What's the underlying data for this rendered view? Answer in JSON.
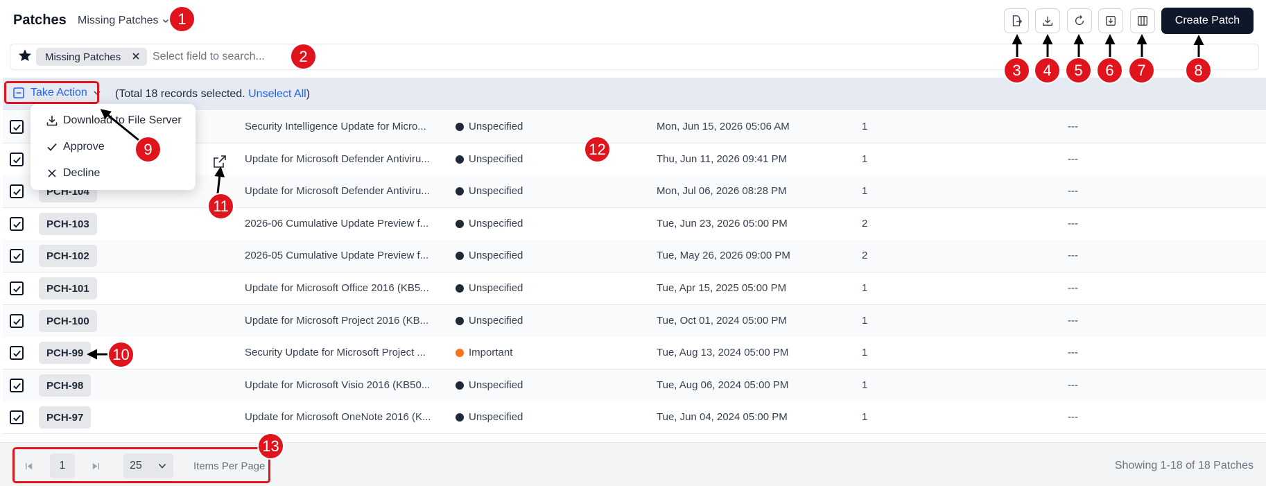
{
  "header": {
    "title": "Patches",
    "view_select": "Missing Patches",
    "create_button": "Create Patch",
    "tools": [
      {
        "name": "export-icon"
      },
      {
        "name": "download-icon"
      },
      {
        "name": "refresh-icon"
      },
      {
        "name": "import-icon"
      },
      {
        "name": "columns-icon"
      }
    ]
  },
  "search": {
    "chip": "Missing Patches",
    "placeholder": "Select field to search..."
  },
  "action_bar": {
    "take_action": "Take Action",
    "selection_text": "(Total 18 records selected.",
    "unselect_all": "Unselect All",
    "close_paren": ")"
  },
  "menu": {
    "items": [
      "Download to File Server",
      "Approve",
      "Decline"
    ]
  },
  "rows": [
    {
      "id": "",
      "name": "Security Intelligence Update for Micro...",
      "severity": "Unspecified",
      "severity_color": "#1f2937",
      "date": "Mon, Jun 15, 2026 05:06 AM",
      "count": "1",
      "extra": "---"
    },
    {
      "id": "",
      "name": "Update for Microsoft Defender Antiviru...",
      "severity": "Unspecified",
      "severity_color": "#1f2937",
      "date": "Thu, Jun 11, 2026 09:41 PM",
      "count": "1",
      "extra": "---"
    },
    {
      "id": "PCH-104",
      "name": "Update for Microsoft Defender Antiviru...",
      "severity": "Unspecified",
      "severity_color": "#1f2937",
      "date": "Mon, Jul 06, 2026 08:28 PM",
      "count": "1",
      "extra": "---"
    },
    {
      "id": "PCH-103",
      "name": "2026-06 Cumulative Update Preview f...",
      "severity": "Unspecified",
      "severity_color": "#1f2937",
      "date": "Tue, Jun 23, 2026 05:00 PM",
      "count": "2",
      "extra": "---"
    },
    {
      "id": "PCH-102",
      "name": "2026-05 Cumulative Update Preview f...",
      "severity": "Unspecified",
      "severity_color": "#1f2937",
      "date": "Tue, May 26, 2026 09:00 PM",
      "count": "2",
      "extra": "---"
    },
    {
      "id": "PCH-101",
      "name": "Update for Microsoft Office 2016 (KB5...",
      "severity": "Unspecified",
      "severity_color": "#1f2937",
      "date": "Tue, Apr 15, 2025 05:00 PM",
      "count": "1",
      "extra": "---"
    },
    {
      "id": "PCH-100",
      "name": "Update for Microsoft Project 2016 (KB...",
      "severity": "Unspecified",
      "severity_color": "#1f2937",
      "date": "Tue, Oct 01, 2024 05:00 PM",
      "count": "1",
      "extra": "---"
    },
    {
      "id": "PCH-99",
      "name": "Security Update for Microsoft Project ...",
      "severity": "Important",
      "severity_color": "#f97316",
      "date": "Tue, Aug 13, 2024 05:00 PM",
      "count": "1",
      "extra": "---"
    },
    {
      "id": "PCH-98",
      "name": "Update for Microsoft Visio 2016 (KB50...",
      "severity": "Unspecified",
      "severity_color": "#1f2937",
      "date": "Tue, Aug 06, 2024 05:00 PM",
      "count": "1",
      "extra": "---"
    },
    {
      "id": "PCH-97",
      "name": "Update for Microsoft OneNote 2016 (K...",
      "severity": "Unspecified",
      "severity_color": "#1f2937",
      "date": "Tue, Jun 04, 2024 05:00 PM",
      "count": "1",
      "extra": "---"
    }
  ],
  "footer": {
    "page": "1",
    "per_page": "25",
    "items_per_page": "Items Per Page",
    "showing": "Showing 1-18 of 18 Patches"
  },
  "annotations": [
    "1",
    "2",
    "3",
    "4",
    "5",
    "6",
    "7",
    "8",
    "9",
    "10",
    "11",
    "12",
    "13"
  ],
  "colors": {
    "annotation": "#e0141d",
    "primary_button": "#0f172a",
    "link": "#2563eb",
    "important": "#f97316"
  }
}
